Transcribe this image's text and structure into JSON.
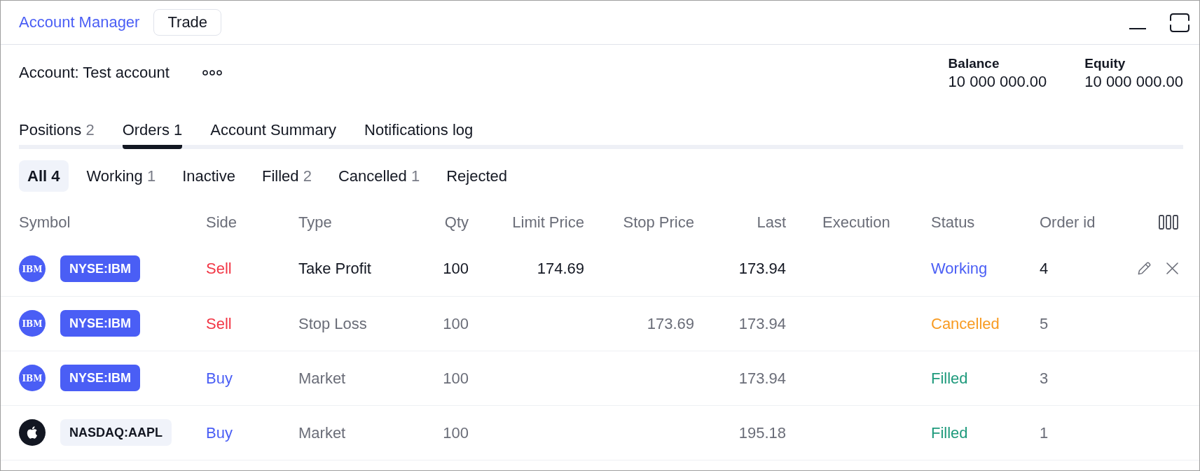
{
  "header": {
    "title": "Account Manager",
    "trade_button": "Trade"
  },
  "account": {
    "label": "Account: Test account"
  },
  "summary": [
    {
      "label": "Balance",
      "value": "10 000 000.00"
    },
    {
      "label": "Equity",
      "value": "10 000 000.00"
    }
  ],
  "tabs": [
    {
      "label": "Positions",
      "count": "2",
      "selected": false
    },
    {
      "label": "Orders",
      "count": "1",
      "selected": true
    },
    {
      "label": "Account Summary",
      "selected": false
    },
    {
      "label": "Notifications log",
      "selected": false
    }
  ],
  "filters": [
    {
      "label": "All",
      "count": "4",
      "selected": true
    },
    {
      "label": "Working",
      "count": "1",
      "selected": false
    },
    {
      "label": "Inactive",
      "selected": false
    },
    {
      "label": "Filled",
      "count": "2",
      "selected": false
    },
    {
      "label": "Cancelled",
      "count": "1",
      "selected": false
    },
    {
      "label": "Rejected",
      "selected": false
    }
  ],
  "table": {
    "columns": [
      "Symbol",
      "Side",
      "Type",
      "Qty",
      "Limit Price",
      "Stop Price",
      "Last",
      "Execution",
      "Status",
      "Order id"
    ],
    "rows": [
      {
        "logo": {
          "kind": "lettermark",
          "text": "IBM"
        },
        "symbol": "NYSE:IBM",
        "highlighted": true,
        "side": {
          "text": "Sell",
          "color": "#f23645"
        },
        "type": "Take Profit",
        "qty": "100",
        "limit_price": "174.69",
        "last": "173.94",
        "status": {
          "text": "Working",
          "color": "#4a5ef5"
        },
        "order_id": "4",
        "dimmed": false,
        "actions": true
      },
      {
        "logo": {
          "kind": "lettermark",
          "text": "IBM"
        },
        "symbol": "NYSE:IBM",
        "highlighted": true,
        "side": {
          "text": "Sell",
          "color": "#f23645"
        },
        "type": "Stop Loss",
        "qty": "100",
        "stop_price": "173.69",
        "last": "173.94",
        "status": {
          "text": "Cancelled",
          "color": "#f89b22"
        },
        "order_id": "5",
        "dimmed": true,
        "actions": false
      },
      {
        "logo": {
          "kind": "lettermark",
          "text": "IBM"
        },
        "symbol": "NYSE:IBM",
        "highlighted": true,
        "side": {
          "text": "Buy",
          "color": "#4a5ef5"
        },
        "type": "Market",
        "qty": "100",
        "last": "173.94",
        "status": {
          "text": "Filled",
          "color": "#1e9a7c"
        },
        "order_id": "3",
        "dimmed": true,
        "actions": false
      },
      {
        "logo": {
          "kind": "apple"
        },
        "symbol": "NASDAQ:AAPL",
        "highlighted": false,
        "side": {
          "text": "Buy",
          "color": "#4a5ef5"
        },
        "type": "Market",
        "qty": "100",
        "last": "195.18",
        "status": {
          "text": "Filled",
          "color": "#1e9a7c"
        },
        "order_id": "1",
        "dimmed": true,
        "actions": false
      }
    ]
  }
}
